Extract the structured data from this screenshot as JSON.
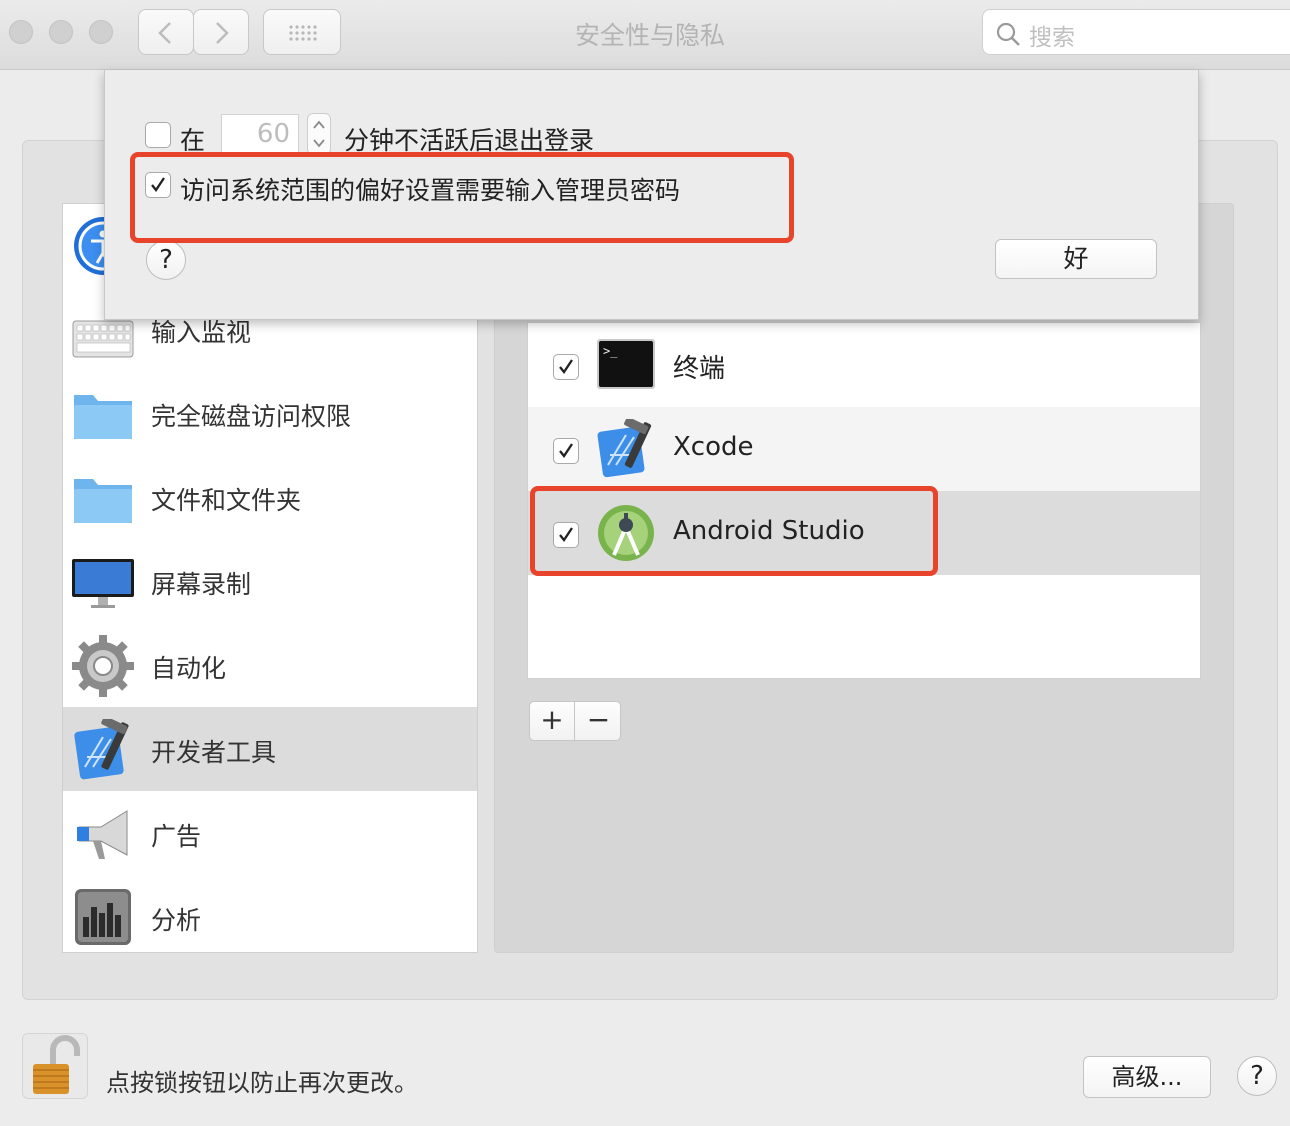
{
  "window": {
    "title": "安全性与隐私",
    "search_placeholder": "搜索"
  },
  "sidebar": {
    "items": [
      {
        "label": "",
        "icon": "accessibility-icon"
      },
      {
        "label": "输入监视",
        "icon": "keyboard-icon"
      },
      {
        "label": "完全磁盘访问权限",
        "icon": "folder-icon"
      },
      {
        "label": "文件和文件夹",
        "icon": "folder-icon"
      },
      {
        "label": "屏幕录制",
        "icon": "display-icon"
      },
      {
        "label": "自动化",
        "icon": "gear-icon"
      },
      {
        "label": "开发者工具",
        "icon": "xcode-icon",
        "selected": true
      },
      {
        "label": "广告",
        "icon": "megaphone-icon"
      },
      {
        "label": "分析",
        "icon": "analytics-icon"
      }
    ]
  },
  "apps": [
    {
      "label": "终端",
      "checked": true,
      "icon": "terminal-icon"
    },
    {
      "label": "Xcode",
      "checked": true,
      "icon": "xcode-icon"
    },
    {
      "label": "Android Studio",
      "checked": true,
      "icon": "android-studio-icon",
      "selected": true
    }
  ],
  "list_controls": {
    "add": "+",
    "remove": "−"
  },
  "sheet": {
    "logout_prefix": "在",
    "logout_minutes": "60",
    "logout_suffix": "分钟不活跃后退出登录",
    "logout_checked": false,
    "admin_password_label": "访问系统范围的偏好设置需要输入管理员密码",
    "admin_password_checked": true,
    "help": "?",
    "ok_label": "好"
  },
  "footer": {
    "lock_text": "点按锁按钮以防止再次更改。",
    "advanced_label": "高级...",
    "help": "?"
  },
  "colors": {
    "highlight_box": "#e8432b",
    "selection": "#dcdcdc"
  }
}
